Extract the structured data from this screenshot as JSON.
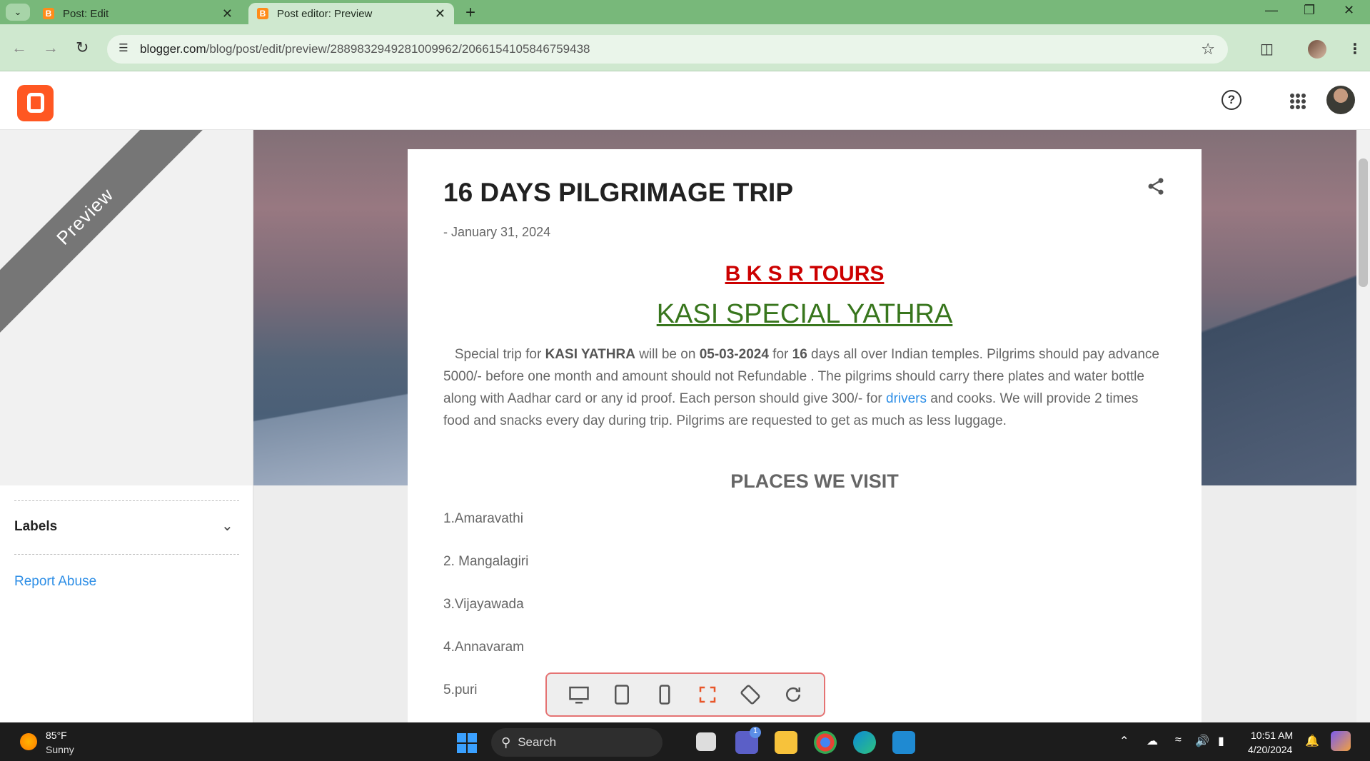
{
  "browser": {
    "tabs": [
      {
        "title": "Post: Edit",
        "active": false
      },
      {
        "title": "Post editor: Preview",
        "active": true
      }
    ],
    "url_host": "blogger.com",
    "url_path": "/blog/post/edit/preview/2889832949281009962/2066154105846759438",
    "new_tab_label": "+"
  },
  "preview_ribbon": "Preview",
  "sidebar": {
    "labels_title": "Labels",
    "report_link": "Report Abuse"
  },
  "post": {
    "title": "16 DAYS PILGRIMAGE TRIP",
    "date": "- January 31, 2024",
    "brand": "B K S R TOURS",
    "subtitle": "KASI SPECIAL YATHRA",
    "para": {
      "t1": "Special trip for ",
      "b1": "KASI YATHRA",
      "t2": " will be on ",
      "b2": "05-03-2024",
      "t3": " for ",
      "b3": "16",
      "t4": " days all over Indian temples. Pilgrims should pay advance 5000/- before one month and amount should not Refundable . The pilgrims should carry there plates and water bottle along with Aadhar card or any id proof. Each person should give 300/- for ",
      "link": "drivers",
      "t5": " and cooks. We will provide 2 times food and snacks every day during trip. Pilgrims are requested to get as much as less luggage."
    },
    "places_heading": "PLACES WE VISIT",
    "places": [
      "1.Amaravathi",
      "2. Mangalagiri",
      "3.Vijayawada",
      "4.Annavaram",
      "5.puri"
    ]
  },
  "device_toolbar": [
    "desktop-icon",
    "tablet-icon",
    "phone-icon",
    "fullscreen-icon",
    "rotate-icon",
    "refresh-icon"
  ],
  "taskbar": {
    "temperature": "85°F",
    "condition": "Sunny",
    "search_label": "Search",
    "time": "10:51 AM",
    "date": "4/20/2024",
    "teams_badge": "1"
  },
  "colors": {
    "brand_red": "#cc0000",
    "subtitle_green": "#38761d",
    "link_blue": "#2d8ee6",
    "blogger_orange": "#ff5722",
    "tabstrip_green": "#78b87a"
  }
}
